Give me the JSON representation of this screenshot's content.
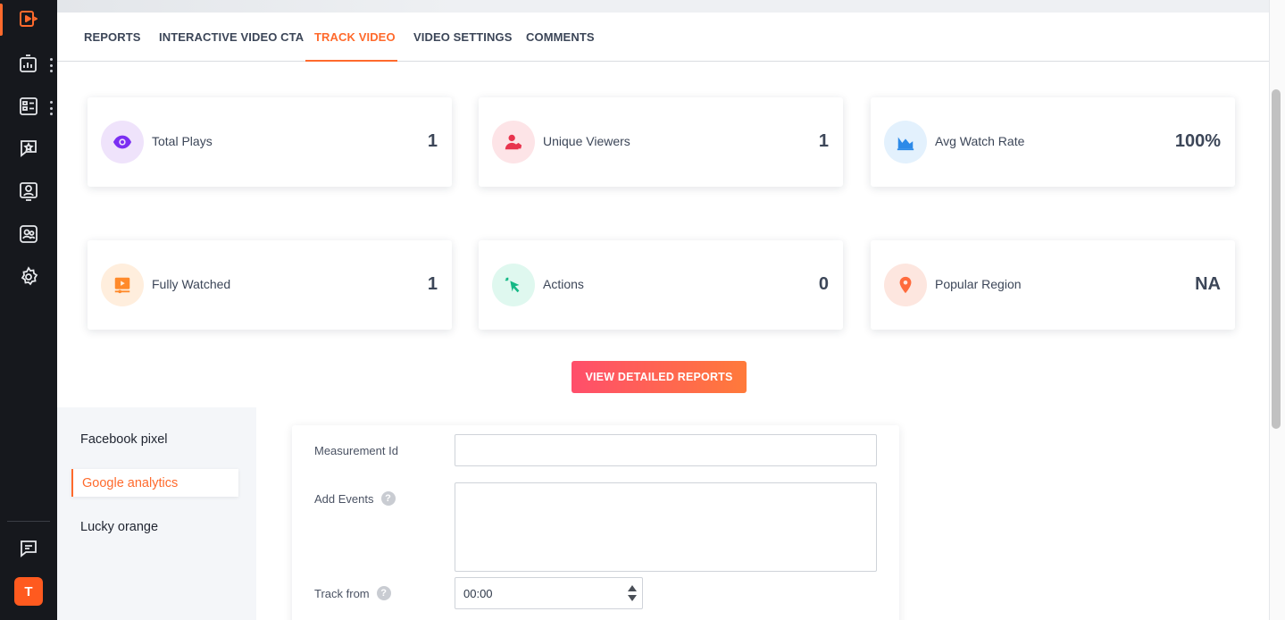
{
  "tabs": [
    {
      "label": "REPORTS"
    },
    {
      "label": "INTERACTIVE VIDEO CTA"
    },
    {
      "label": "TRACK VIDEO"
    },
    {
      "label": "VIDEO SETTINGS"
    },
    {
      "label": "COMMENTS"
    }
  ],
  "active_tab": "TRACK VIDEO",
  "stats": [
    {
      "label": "Total Plays",
      "value": "1",
      "icon": "eye-icon",
      "icon_bg": "#efe3fb",
      "icon_color": "#7b2ff2"
    },
    {
      "label": "Unique Viewers",
      "value": "1",
      "icon": "users-icon",
      "icon_bg": "#fde4e7",
      "icon_color": "#e8344e"
    },
    {
      "label": "Avg Watch Rate",
      "value": "100%",
      "icon": "area-chart-icon",
      "icon_bg": "#e3f1fd",
      "icon_color": "#2d8ae8"
    },
    {
      "label": "Fully Watched",
      "value": "1",
      "icon": "video-play-icon",
      "icon_bg": "#ffeedd",
      "icon_color": "#ff8a2b"
    },
    {
      "label": "Actions",
      "value": "0",
      "icon": "cursor-click-icon",
      "icon_bg": "#dff8ef",
      "icon_color": "#14b885"
    },
    {
      "label": "Popular Region",
      "value": "NA",
      "icon": "map-pin-icon",
      "icon_bg": "#fde6df",
      "icon_color": "#ff6b3d"
    }
  ],
  "cta": {
    "label": "VIEW DETAILED REPORTS"
  },
  "integrations": [
    {
      "label": "Facebook pixel"
    },
    {
      "label": "Google analytics"
    },
    {
      "label": "Lucky orange"
    }
  ],
  "active_integration": "Google analytics",
  "form": {
    "measurement_label": "Measurement Id",
    "measurement_value": "",
    "events_label": "Add Events",
    "events_value": "",
    "track_from_label": "Track from",
    "track_from_value": "00:00",
    "help_glyph": "?"
  },
  "user": {
    "initial": "T"
  },
  "colors": {
    "accent": "#ff6a2c",
    "rail": "#16181d",
    "cta_start": "#ff4e6b",
    "cta_end": "#ff7a3a"
  }
}
